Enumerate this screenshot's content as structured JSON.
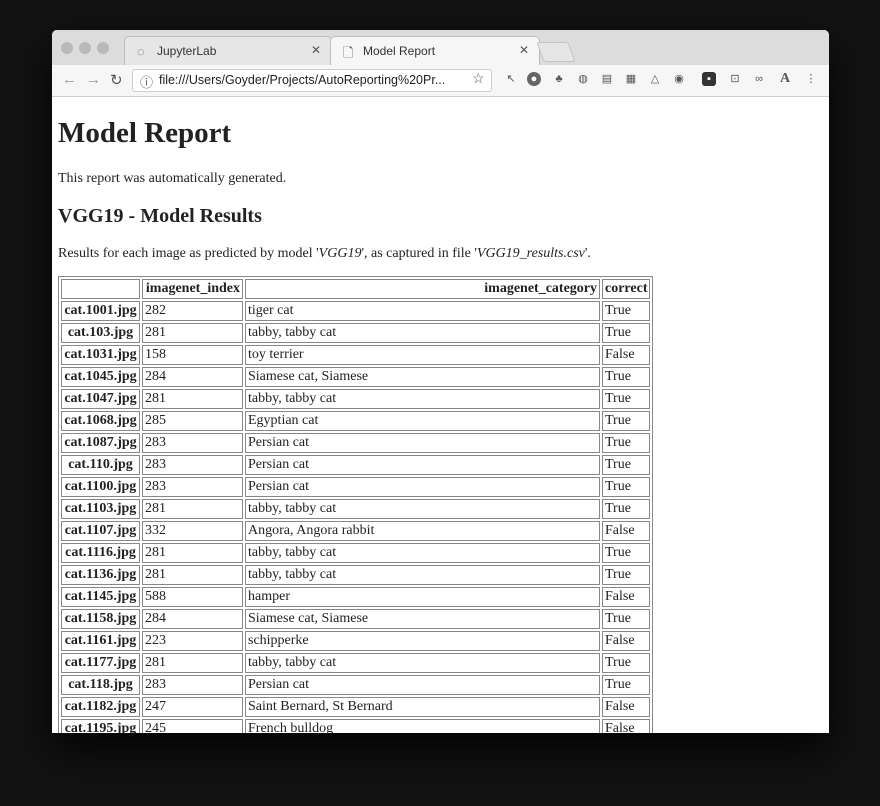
{
  "browser": {
    "tabs": [
      {
        "label": "JupyterLab",
        "icon": "spinner-icon"
      },
      {
        "label": "Model Report",
        "icon": "document-icon"
      }
    ],
    "url": "file:///Users/Goyder/Projects/AutoReporting%20Pr..."
  },
  "page": {
    "title": "Model Report",
    "lead": "This report was automatically generated.",
    "section_title": "VGG19 - Model Results",
    "desc_prefix": "Results for each image as predicted by model '",
    "model_name": "VGG19",
    "desc_middle": "', as captured in file '",
    "file_name": "VGG19_results.csv",
    "desc_suffix": "'."
  },
  "table": {
    "columns": [
      "",
      "imagenet_index",
      "imagenet_category",
      "correct"
    ],
    "rows": [
      [
        "cat.1001.jpg",
        "282",
        "tiger cat",
        "True"
      ],
      [
        "cat.103.jpg",
        "281",
        "tabby, tabby cat",
        "True"
      ],
      [
        "cat.1031.jpg",
        "158",
        "toy terrier",
        "False"
      ],
      [
        "cat.1045.jpg",
        "284",
        "Siamese cat, Siamese",
        "True"
      ],
      [
        "cat.1047.jpg",
        "281",
        "tabby, tabby cat",
        "True"
      ],
      [
        "cat.1068.jpg",
        "285",
        "Egyptian cat",
        "True"
      ],
      [
        "cat.1087.jpg",
        "283",
        "Persian cat",
        "True"
      ],
      [
        "cat.110.jpg",
        "283",
        "Persian cat",
        "True"
      ],
      [
        "cat.1100.jpg",
        "283",
        "Persian cat",
        "True"
      ],
      [
        "cat.1103.jpg",
        "281",
        "tabby, tabby cat",
        "True"
      ],
      [
        "cat.1107.jpg",
        "332",
        "Angora, Angora rabbit",
        "False"
      ],
      [
        "cat.1116.jpg",
        "281",
        "tabby, tabby cat",
        "True"
      ],
      [
        "cat.1136.jpg",
        "281",
        "tabby, tabby cat",
        "True"
      ],
      [
        "cat.1145.jpg",
        "588",
        "hamper",
        "False"
      ],
      [
        "cat.1158.jpg",
        "284",
        "Siamese cat, Siamese",
        "True"
      ],
      [
        "cat.1161.jpg",
        "223",
        "schipperke",
        "False"
      ],
      [
        "cat.1177.jpg",
        "281",
        "tabby, tabby cat",
        "True"
      ],
      [
        "cat.118.jpg",
        "283",
        "Persian cat",
        "True"
      ],
      [
        "cat.1182.jpg",
        "247",
        "Saint Bernard, St Bernard",
        "False"
      ],
      [
        "cat.1195.jpg",
        "245",
        "French bulldog",
        "False"
      ]
    ]
  }
}
